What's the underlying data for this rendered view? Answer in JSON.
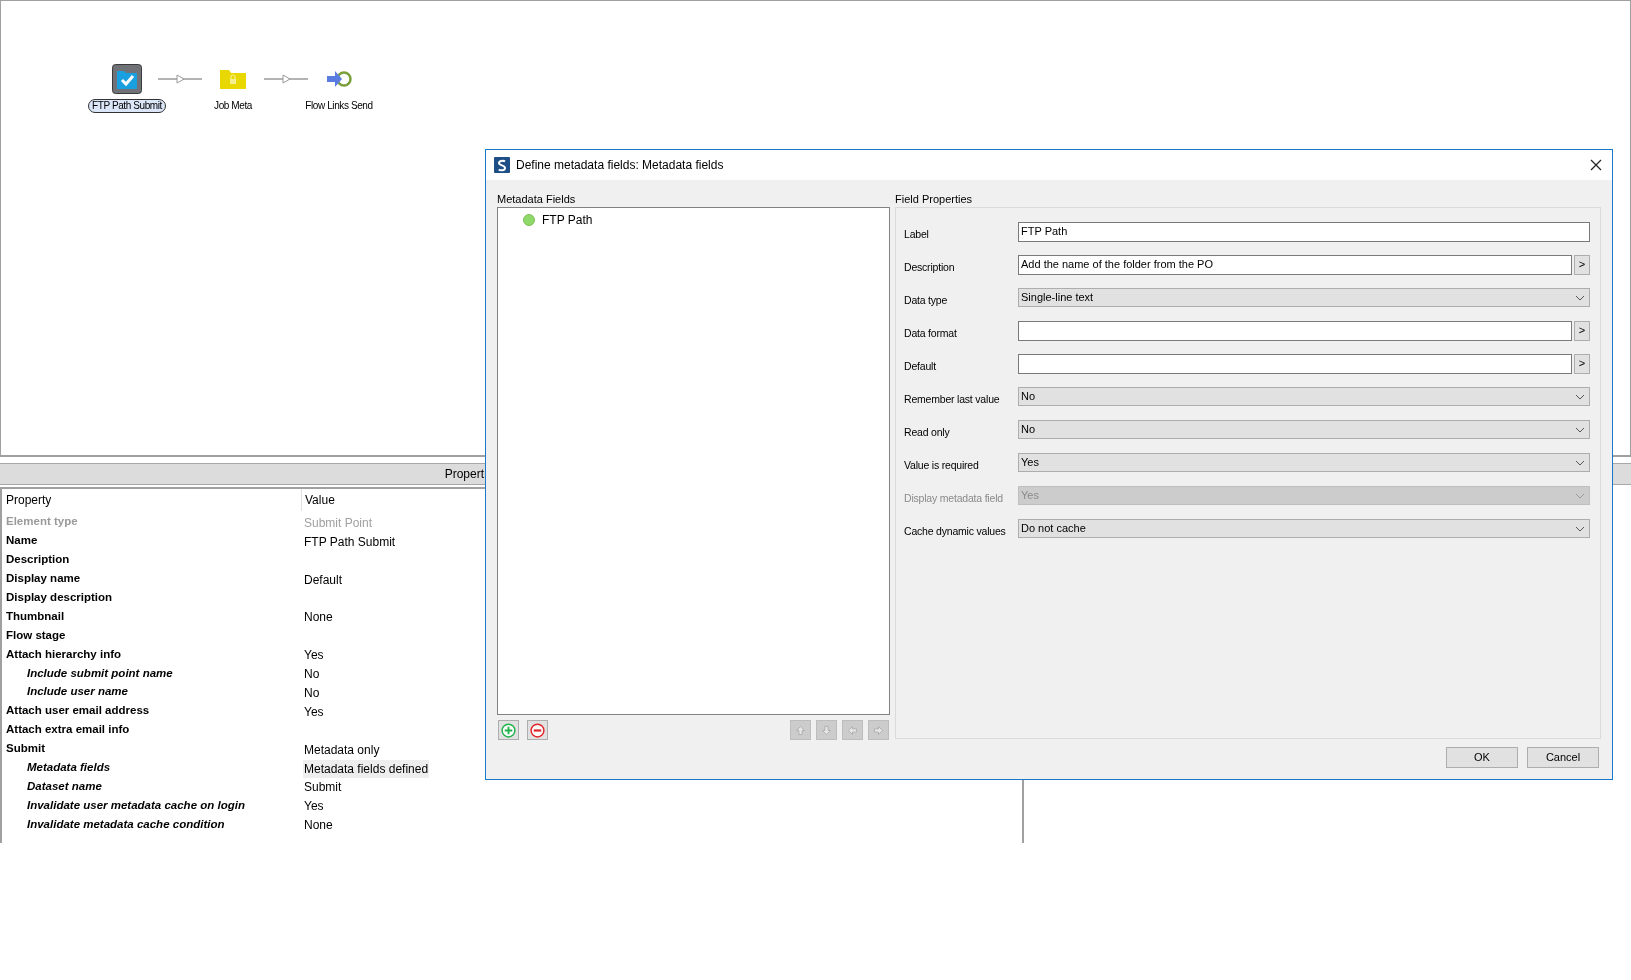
{
  "flow": {
    "nodes": [
      {
        "kind": "submit",
        "label": "FTP Path Submit",
        "selected": true
      },
      {
        "kind": "folder",
        "label": "Job Meta",
        "selected": false
      },
      {
        "kind": "send",
        "label": "Flow Links Send",
        "selected": false
      }
    ]
  },
  "properties": {
    "title": "Propert",
    "columns": [
      "Property",
      "Value"
    ],
    "rows": [
      {
        "property": "Element type",
        "value": "Submit Point",
        "disabled": true,
        "nested": false
      },
      {
        "property": "Name",
        "value": "FTP Path Submit",
        "disabled": false,
        "nested": false
      },
      {
        "property": "Description",
        "disabled": false,
        "nested": false
      },
      {
        "property": "Display name",
        "value": "Default",
        "disabled": false,
        "nested": false
      },
      {
        "property": "Display description",
        "disabled": false,
        "nested": false
      },
      {
        "property": "Thumbnail",
        "value": "None",
        "disabled": false,
        "nested": false
      },
      {
        "property": "Flow stage",
        "disabled": false,
        "nested": false
      },
      {
        "property": "Attach hierarchy info",
        "value": "Yes",
        "disabled": false,
        "nested": false
      },
      {
        "property": "Include submit point name",
        "value": "No",
        "disabled": false,
        "nested": true
      },
      {
        "property": "Include user name",
        "value": "No",
        "disabled": false,
        "nested": true
      },
      {
        "property": "Attach user email address",
        "value": "Yes",
        "disabled": false,
        "nested": false
      },
      {
        "property": "Attach extra email info",
        "disabled": false,
        "nested": false
      },
      {
        "property": "Submit",
        "value": "Metadata only",
        "disabled": false,
        "nested": false
      },
      {
        "property": "Metadata fields",
        "value": "Metadata fields defined",
        "disabled": false,
        "nested": true,
        "selected": true
      },
      {
        "property": "Dataset name",
        "value": "Submit",
        "disabled": false,
        "nested": true
      },
      {
        "property": "Invalidate user metadata cache on login",
        "value": "Yes",
        "disabled": false,
        "nested": true
      },
      {
        "property": "Invalidate metadata cache condition",
        "value": "None",
        "disabled": false,
        "nested": true
      }
    ]
  },
  "dialog": {
    "title": "Define metadata fields: Metadata fields",
    "metadata_fields": {
      "heading": "Metadata Fields",
      "items": [
        {
          "label": "FTP Path",
          "color": "#8fd86a"
        }
      ]
    },
    "field_properties": {
      "heading": "Field Properties",
      "fields": [
        {
          "kind": "text",
          "label": "Label",
          "value": "FTP Path",
          "disabled": false
        },
        {
          "kind": "text_more",
          "label": "Description",
          "value": "Add the name of the folder from the PO",
          "disabled": false,
          "more": ">"
        },
        {
          "kind": "select",
          "label": "Data type",
          "value": "Single-line text",
          "disabled": false
        },
        {
          "kind": "text_more",
          "label": "Data format",
          "disabled": false,
          "more": ">"
        },
        {
          "kind": "text_more",
          "label": "Default",
          "disabled": false,
          "more": ">"
        },
        {
          "kind": "select",
          "label": "Remember last value",
          "value": "No",
          "disabled": false
        },
        {
          "kind": "select",
          "label": "Read only",
          "value": "No",
          "disabled": false
        },
        {
          "kind": "select",
          "label": "Value is required",
          "value": "Yes",
          "disabled": false
        },
        {
          "kind": "select",
          "label": "Display metadata field",
          "value": "Yes",
          "disabled": true
        },
        {
          "kind": "select",
          "label": "Cache dynamic values",
          "value": "Do not cache",
          "disabled": false
        }
      ]
    },
    "buttons": [
      "OK",
      "Cancel"
    ]
  }
}
